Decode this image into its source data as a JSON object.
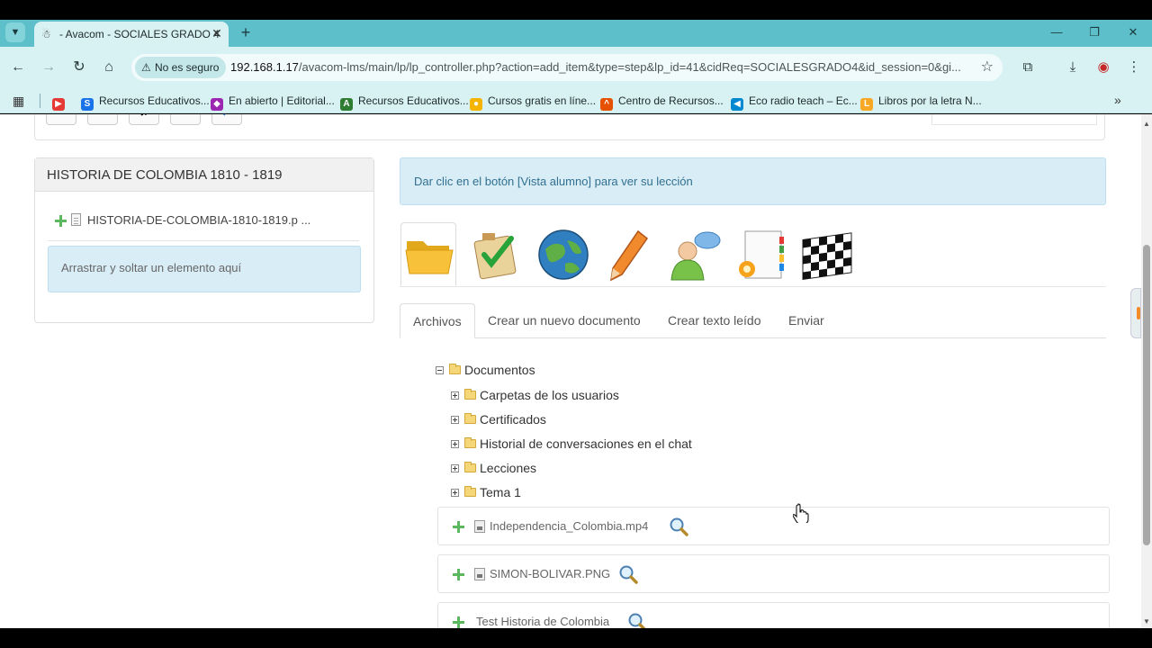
{
  "browser": {
    "tab_title": "- Avacom - SOCIALES GRADO 4",
    "security_label": "No es seguro",
    "url_host": "192.168.1.17",
    "url_path": "/avacom-lms/main/lp/lp_controller.php?action=add_item&type=step&lp_id=41&cidReq=SOCIALESGRADO4&id_session=0&gi..."
  },
  "bookmarks": [
    {
      "label": "Recursos Educativos...",
      "color": "#1a73e8",
      "glyph": "S"
    },
    {
      "label": "En abierto | Editorial...",
      "color": "#9c27b0",
      "glyph": "◆"
    },
    {
      "label": "Recursos Educativos...",
      "color": "#2e7d32",
      "glyph": "A"
    },
    {
      "label": "Cursos gratis en líne...",
      "color": "#f4b400",
      "glyph": "●"
    },
    {
      "label": "Centro de Recursos...",
      "color": "#e65100",
      "glyph": "^"
    },
    {
      "label": "Eco radio teach – Ec...",
      "color": "#0288d1",
      "glyph": "◀"
    },
    {
      "label": "Libros por la letra N...",
      "color": "#f9a825",
      "glyph": "L"
    }
  ],
  "lesson": {
    "title": "HISTORIA DE COLOMBIA 1810 - 1819",
    "item_label": "HISTORIA-DE-COLOMBIA-1810-1819.p ...",
    "dropzone_text": "Arrastrar y soltar un elemento aquí"
  },
  "info_message": "Dar clic en el botón [Vista alumno] para ver su lección",
  "tool_icons": [
    "folder-icon",
    "quiz-icon",
    "link-icon",
    "assignment-icon",
    "forum-icon",
    "document-icon",
    "final-item-icon"
  ],
  "tabs": [
    "Archivos",
    "Crear un nuevo documento",
    "Crear texto leído",
    "Enviar"
  ],
  "tree": {
    "root": "Documentos",
    "children": [
      "Carpetas de los usuarios",
      "Certificados",
      "Historial de conversaciones en el chat",
      "Lecciones",
      "Tema 1"
    ]
  },
  "files": [
    "Independencia_Colombia.mp4",
    "SIMON-BOLIVAR.PNG",
    "Test Historia de Colombia"
  ]
}
